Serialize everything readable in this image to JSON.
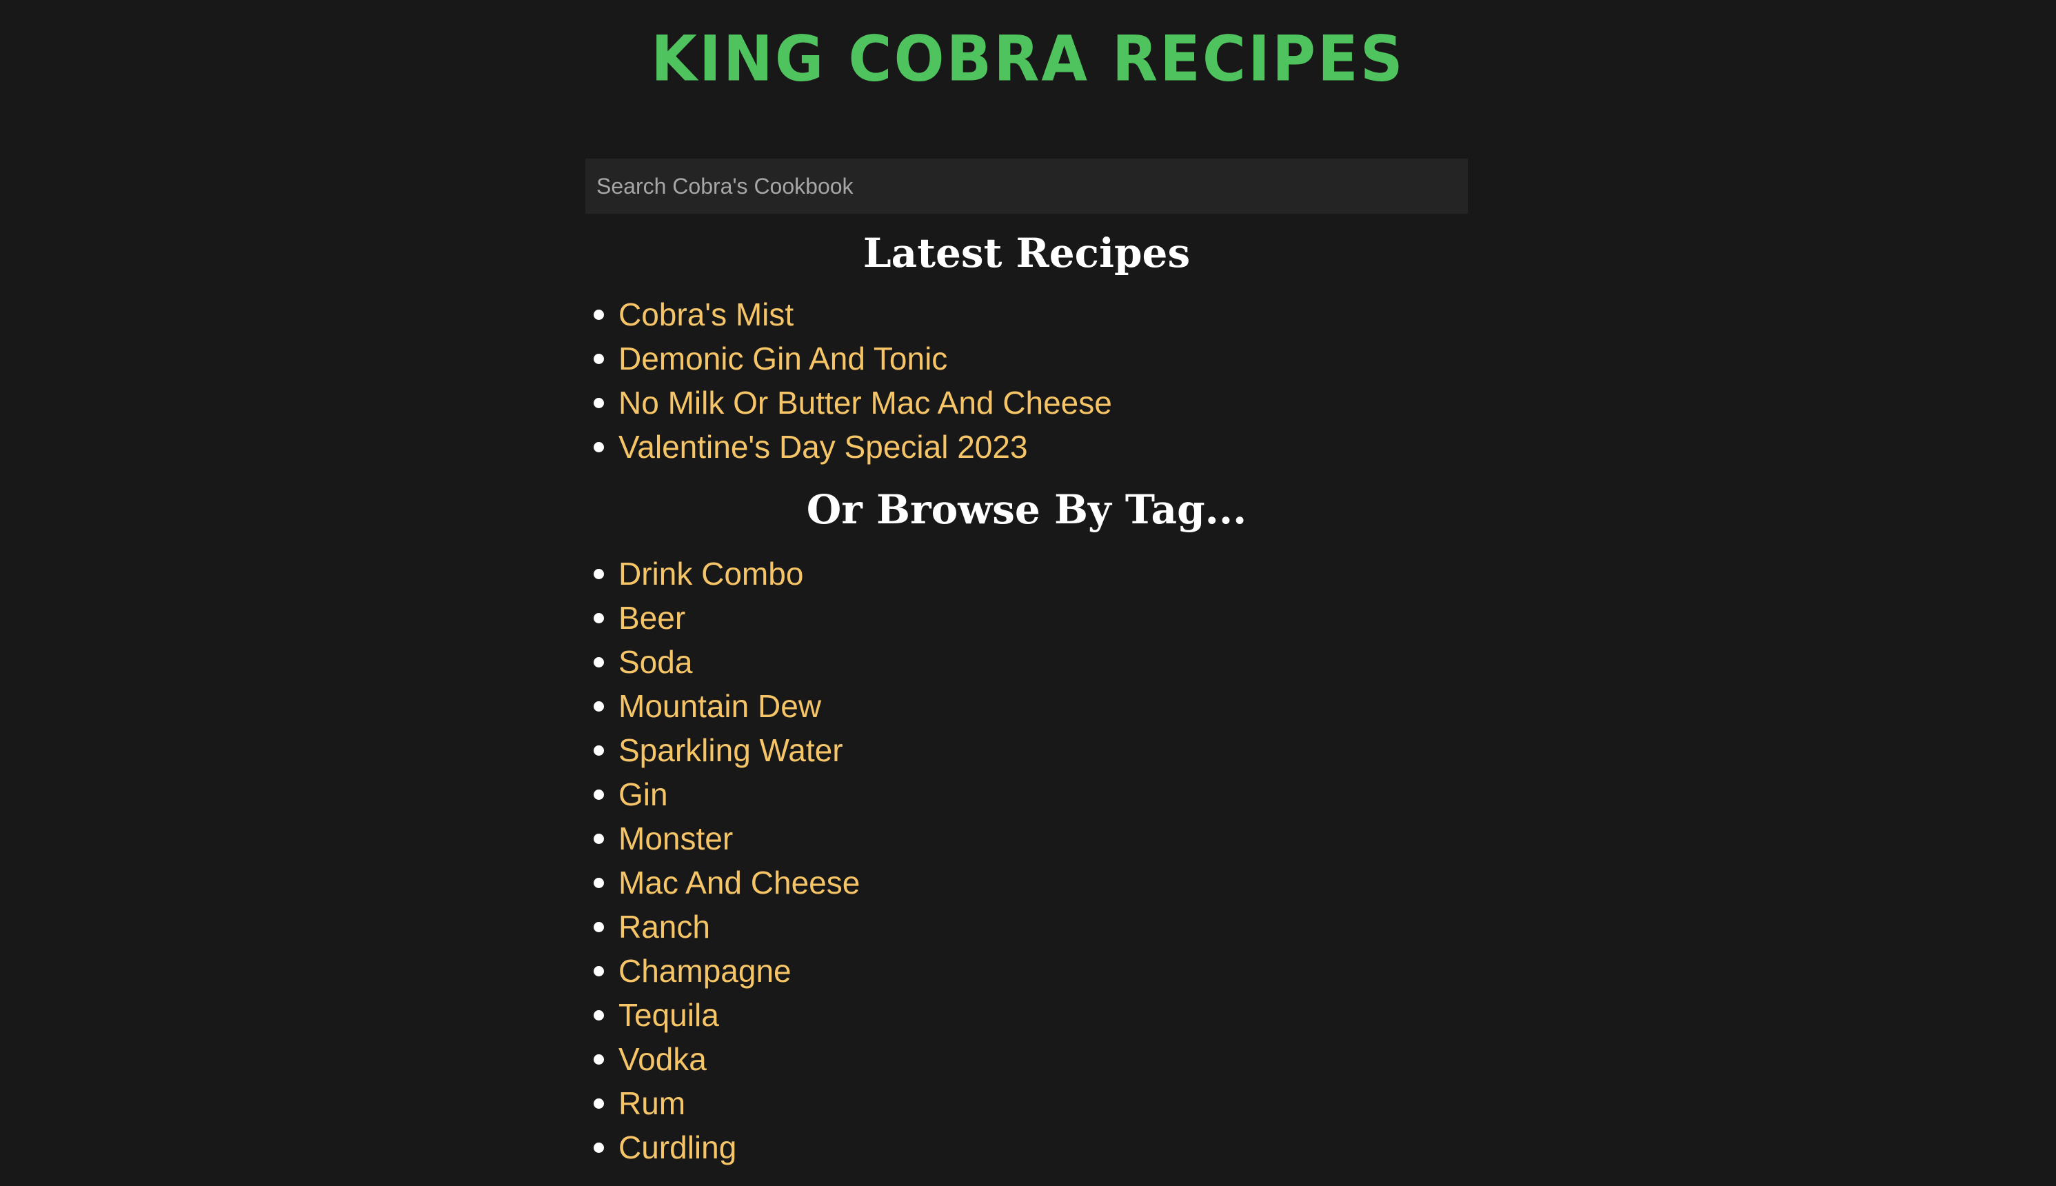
{
  "site": {
    "title": "KING COBRA RECIPES"
  },
  "search": {
    "placeholder": "Search Cobra's Cookbook",
    "value": ""
  },
  "latest": {
    "heading": "Latest Recipes",
    "items": [
      {
        "label": "Cobra's Mist"
      },
      {
        "label": "Demonic Gin And Tonic"
      },
      {
        "label": "No Milk Or Butter Mac And Cheese"
      },
      {
        "label": "Valentine's Day Special 2023"
      }
    ]
  },
  "browse": {
    "heading": "Or Browse By Tag...",
    "items": [
      {
        "label": "Drink Combo"
      },
      {
        "label": "Beer"
      },
      {
        "label": "Soda"
      },
      {
        "label": "Mountain Dew"
      },
      {
        "label": "Sparkling Water"
      },
      {
        "label": "Gin"
      },
      {
        "label": "Monster"
      },
      {
        "label": "Mac And Cheese"
      },
      {
        "label": "Ranch"
      },
      {
        "label": "Champagne"
      },
      {
        "label": "Tequila"
      },
      {
        "label": "Vodka"
      },
      {
        "label": "Rum"
      },
      {
        "label": "Curdling"
      }
    ]
  },
  "colors": {
    "background": "#181818",
    "title": "#4fc35d",
    "link": "#f6c567",
    "heading": "#ffffff",
    "search_background": "#242424"
  },
  "icons": {
    "bullet": "bullet-dot-icon"
  }
}
